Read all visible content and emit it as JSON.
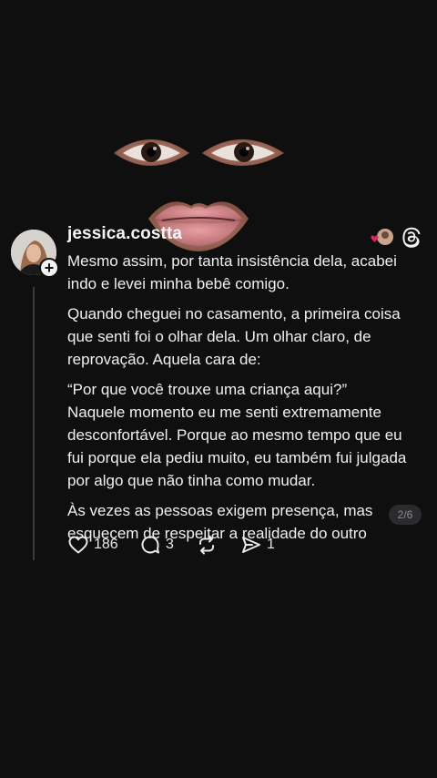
{
  "post": {
    "username": "jessica.costta",
    "paragraphs": [
      "Mesmo assim, por tanta insistência dela, acabei indo e levei minha bebê comigo.",
      "Quando cheguei no casamento, a primeira coisa que senti foi o olhar dela. Um olhar claro, de reprovação. Aquela cara de:",
      "“Por que você trouxe uma criança aqui?”",
      "Naquele momento eu me senti extremamente desconfortável. Porque ao mesmo tempo que eu fui porque ela pediu muito, eu também fui julgada por algo que não tinha como mudar.",
      "Às vezes as pessoas exigem presença, mas esquecem de respeitar a realidade do outro"
    ],
    "page_indicator": "2/6",
    "likes": "186",
    "replies": "3",
    "reposts": "",
    "shares": "1"
  },
  "icons": {
    "follow": "plus-icon",
    "brand": "threads-logo-icon",
    "like": "heart-icon",
    "reply": "comment-bubble-icon",
    "repost": "repost-icon",
    "share": "send-icon"
  },
  "colors": {
    "background": "#0f0f10",
    "text": "#f0f0f0",
    "muted": "#8e8e93",
    "heart_badge": "#e0245e"
  }
}
